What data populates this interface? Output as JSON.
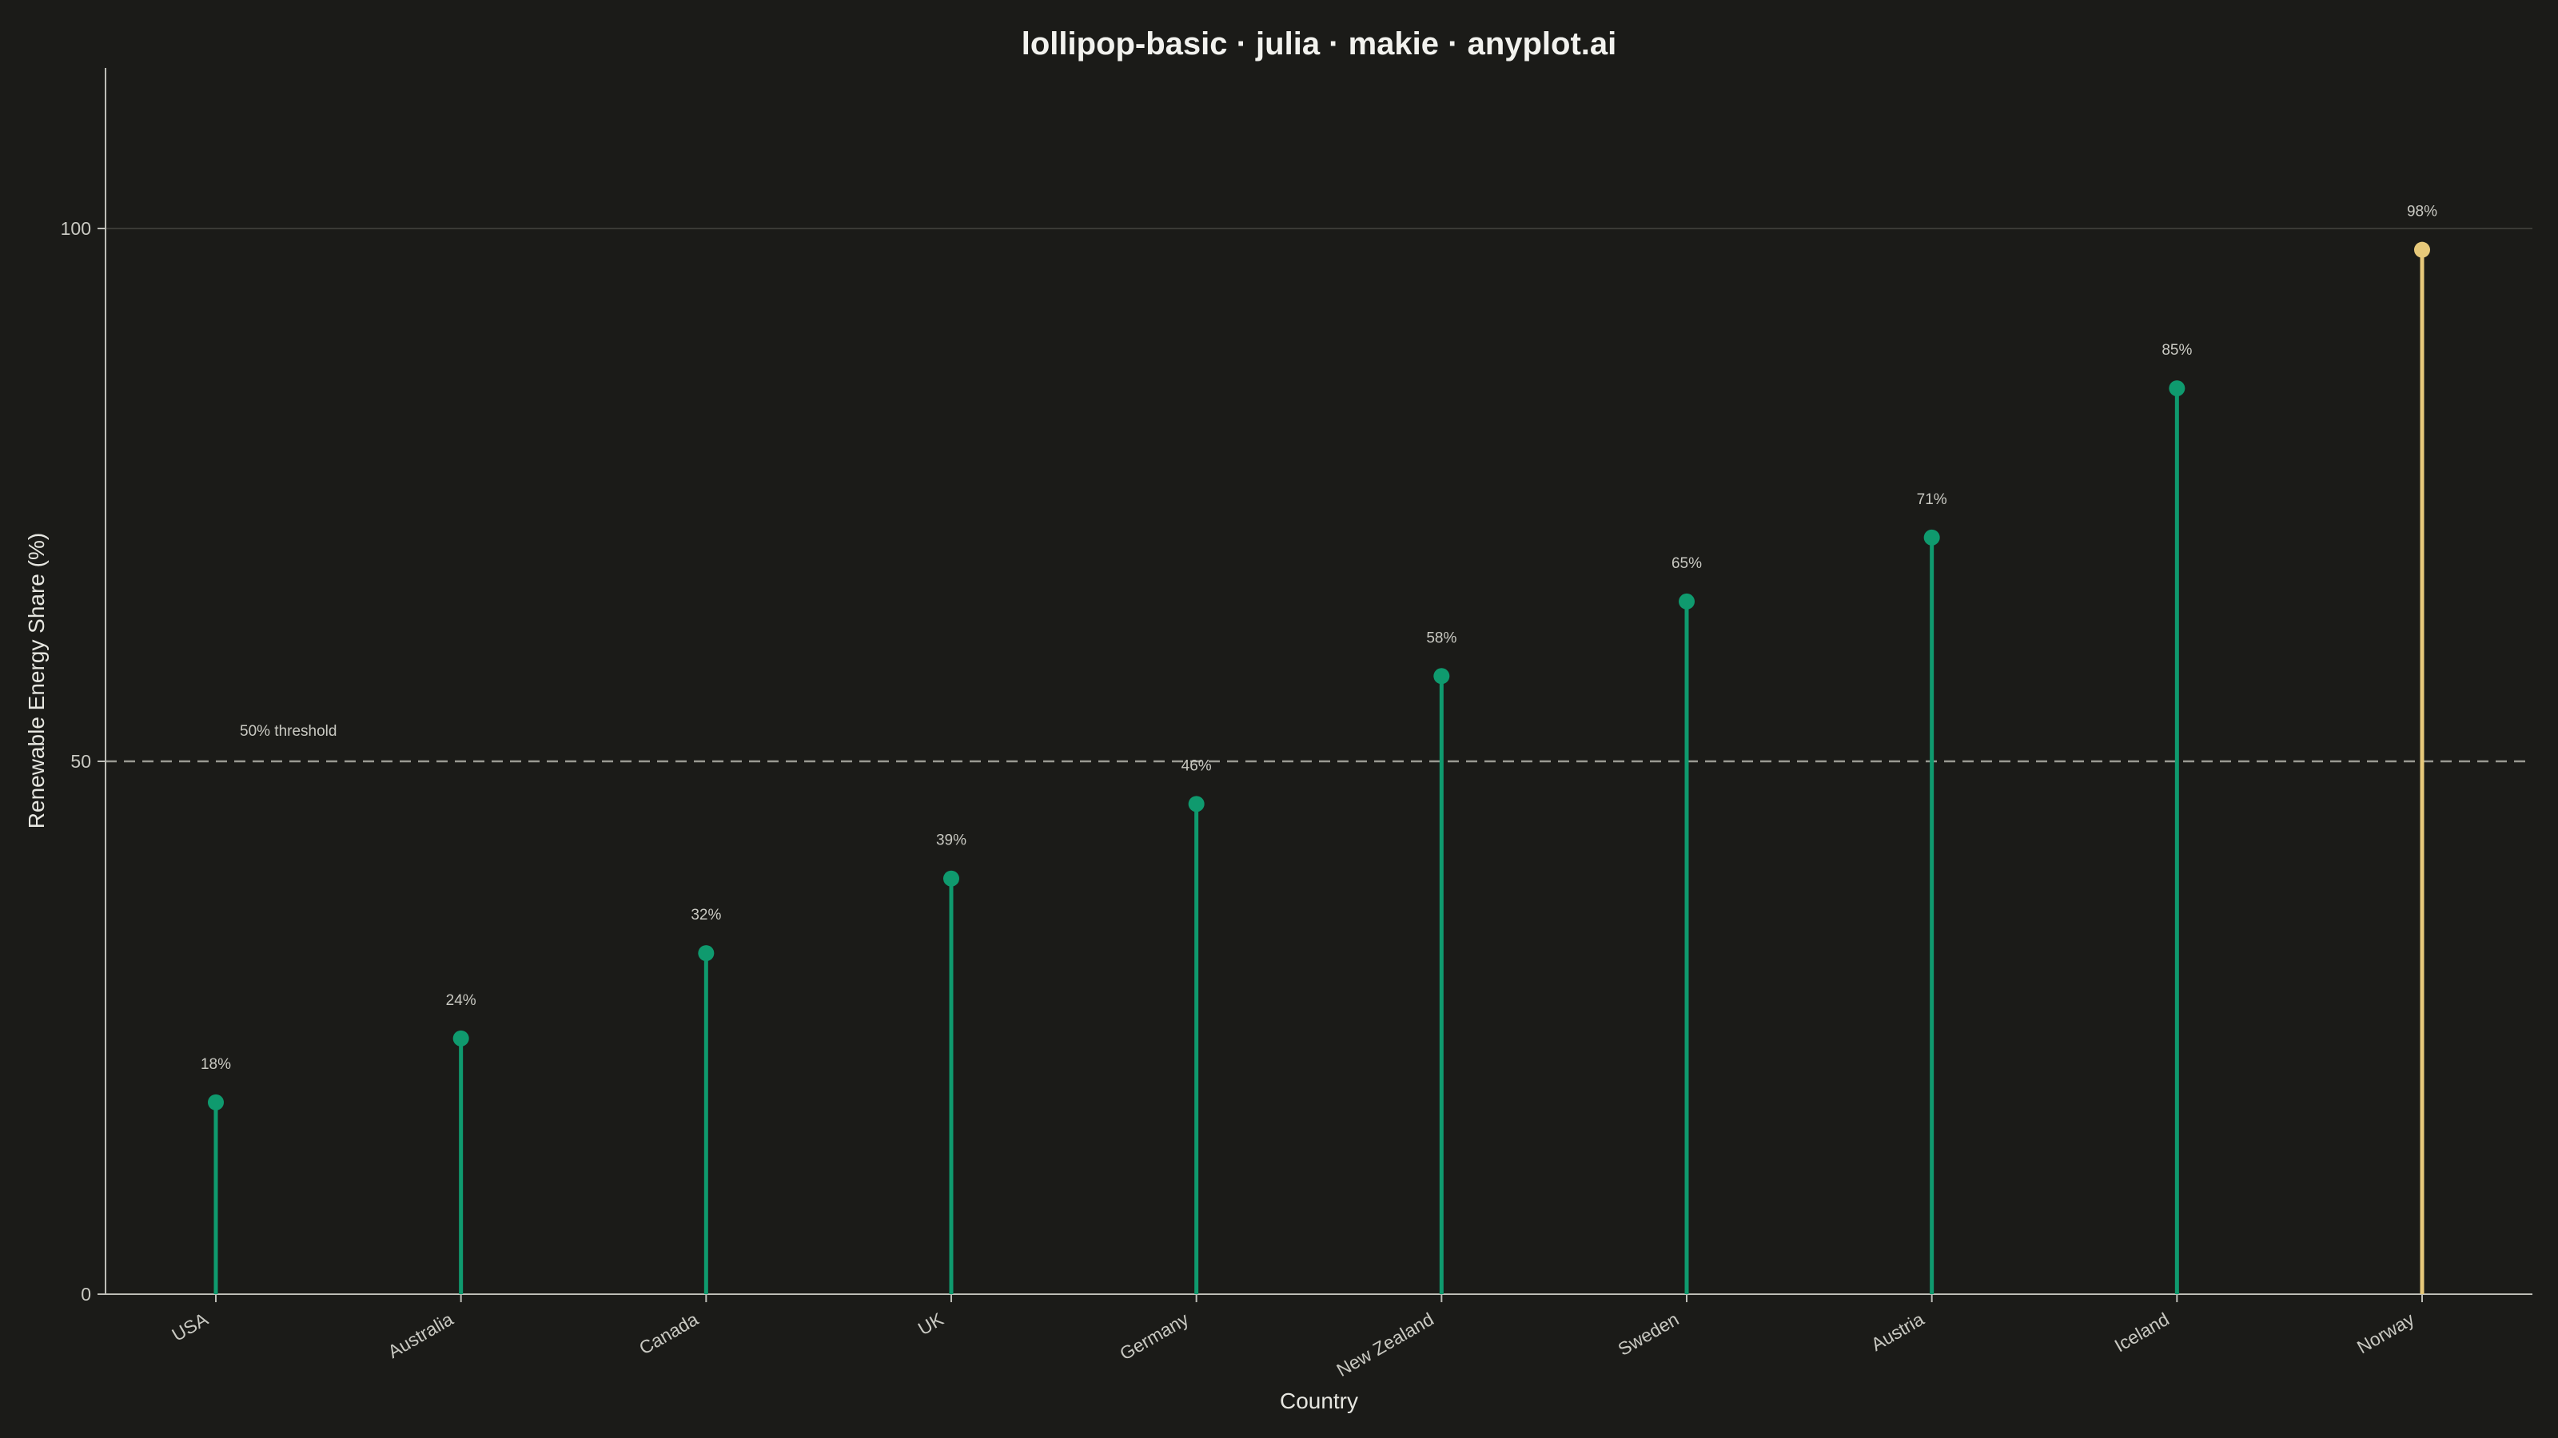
{
  "chart_data": {
    "type": "lollipop",
    "title": "lollipop-basic · julia · makie · anyplot.ai",
    "xlabel": "Country",
    "ylabel": "Renewable Energy Share (%)",
    "categories": [
      "USA",
      "Australia",
      "Canada",
      "UK",
      "Germany",
      "New Zealand",
      "Sweden",
      "Austria",
      "Iceland",
      "Norway"
    ],
    "values": [
      18,
      24,
      32,
      39,
      46,
      58,
      65,
      71,
      85,
      98
    ],
    "value_labels": [
      "18%",
      "24%",
      "32%",
      "39%",
      "46%",
      "58%",
      "65%",
      "71%",
      "85%",
      "98%"
    ],
    "ylim": [
      0,
      100
    ],
    "yticks": [
      0,
      50,
      100
    ],
    "ytick_labels": [
      "0",
      "50",
      "100"
    ],
    "grid": "horizontal",
    "reference_line": {
      "value": 50,
      "label": "50% threshold",
      "style": "dashed"
    },
    "highlight_category": "Norway",
    "colors": {
      "background": "#1b1b18",
      "stem": "#0f9a6e",
      "marker": "#0f9a6e",
      "highlight": "#e7c97a",
      "reference": "#9a9a92",
      "grid": "#3a3a35",
      "axis": "#bdbdb6"
    }
  }
}
